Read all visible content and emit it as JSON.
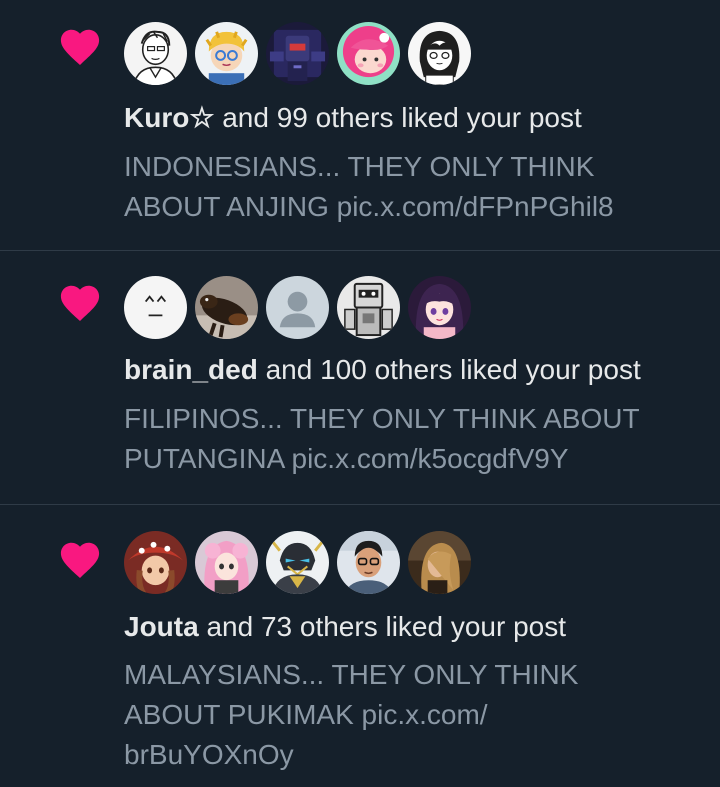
{
  "colors": {
    "background": "#15202b",
    "heart": "#f91880",
    "primary_text": "#e7e9ea",
    "secondary_text": "#8b98a5",
    "divider": "#2f3b47"
  },
  "notifications": [
    {
      "icon": "heart-icon",
      "username": "Kuro☆",
      "liked_text": " and 99 others liked your post",
      "post_line1": "INDONESIANS... THEY ONLY THINK",
      "post_line2_text": "ABOUT ANJING ",
      "post_link": "pic.x.com/dFPnPGhil8",
      "post_link_tail": "",
      "avatars": [
        "avatar-sketch-man",
        "avatar-blonde-boy",
        "avatar-robot",
        "avatar-pink-hair",
        "avatar-sketch-girl"
      ]
    },
    {
      "icon": "heart-icon",
      "username": "brain_ded",
      "liked_text": " and 100 others liked your post",
      "post_line1": "FILIPINOS... THEY ONLY THINK ABOUT",
      "post_line2_text": "PUTANGINA ",
      "post_link": "pic.x.com/k5ocgdfV9Y",
      "post_link_tail": "",
      "avatars": [
        "avatar-face-emoticon",
        "avatar-dog",
        "avatar-default-person",
        "avatar-robot-gray",
        "avatar-anime-girl"
      ]
    },
    {
      "icon": "heart-icon",
      "username": "Jouta",
      "liked_text": " and 73 others liked your post",
      "post_line1": "MALAYSIANS... THEY ONLY THINK",
      "post_line2_text": "ABOUT PUKIMAK ",
      "post_link": "pic.x.com/",
      "post_link_tail": "brBuYOXnOy",
      "avatars": [
        "avatar-red-hat-girl",
        "avatar-pink-hair-girl",
        "avatar-armored-hero",
        "avatar-man-glasses",
        "avatar-blonde-long-hair"
      ]
    }
  ]
}
